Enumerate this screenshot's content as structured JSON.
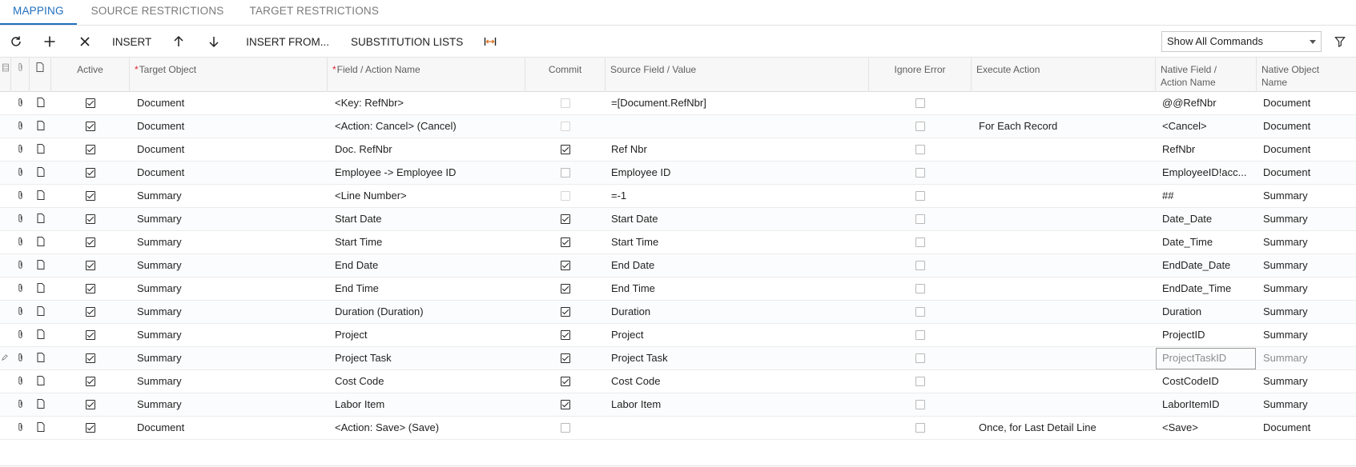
{
  "tabs": [
    {
      "label": "MAPPING",
      "active": true
    },
    {
      "label": "SOURCE RESTRICTIONS",
      "active": false
    },
    {
      "label": "TARGET RESTRICTIONS",
      "active": false
    }
  ],
  "toolbar": {
    "refresh_icon": "refresh-icon",
    "add_icon": "plus-icon",
    "delete_icon": "close-icon",
    "insert_label": "INSERT",
    "move_up_icon": "arrow-up-icon",
    "move_down_icon": "arrow-down-icon",
    "insert_from_label": "INSERT FROM...",
    "substitution_lists_label": "SUBSTITUTION LISTS",
    "fit_columns_icon": "fit-columns-icon",
    "commands_select": {
      "value": "Show All Commands"
    },
    "filter_icon": "filter-icon"
  },
  "grid": {
    "headers": {
      "active": "Active",
      "target_object": "Target Object",
      "field_action_name": "Field / Action Name",
      "commit": "Commit",
      "source_field_value": "Source Field / Value",
      "ignore_error": "Ignore Error",
      "execute_action": "Execute Action",
      "native_field_line1": "Native Field /",
      "native_field_line2": "Action Name",
      "native_object_line1": "Native Object",
      "native_object_line2": "Name"
    },
    "rows": [
      {
        "active": true,
        "target": "Document",
        "field": "<Key: RefNbr>",
        "commit": false,
        "commit_disabled": true,
        "source": "=[Document.RefNbr]",
        "ignore": false,
        "execute": "",
        "native_field": "@@RefNbr",
        "native_object": "Document"
      },
      {
        "active": true,
        "target": "Document",
        "field": "<Action: Cancel> (Cancel)",
        "commit": false,
        "commit_disabled": true,
        "source": "",
        "ignore": false,
        "execute": "For Each Record",
        "native_field": "<Cancel>",
        "native_object": "Document"
      },
      {
        "active": true,
        "target": "Document",
        "field": "Doc. RefNbr",
        "commit": true,
        "commit_disabled": false,
        "source": "Ref Nbr",
        "ignore": false,
        "execute": "",
        "native_field": "RefNbr",
        "native_object": "Document"
      },
      {
        "active": true,
        "target": "Document",
        "field": "Employee -> Employee ID",
        "commit": false,
        "commit_disabled": false,
        "source": "Employee ID",
        "ignore": false,
        "execute": "",
        "native_field": "EmployeeID!acc...",
        "native_object": "Document"
      },
      {
        "active": true,
        "target": "Summary",
        "field": "<Line Number>",
        "commit": false,
        "commit_disabled": true,
        "source": "=-1",
        "ignore": false,
        "execute": "",
        "native_field": "##",
        "native_object": "Summary"
      },
      {
        "active": true,
        "target": "Summary",
        "field": "Start Date",
        "commit": true,
        "commit_disabled": false,
        "source": "Start Date",
        "ignore": false,
        "execute": "",
        "native_field": "Date_Date",
        "native_object": "Summary"
      },
      {
        "active": true,
        "target": "Summary",
        "field": "Start Time",
        "commit": true,
        "commit_disabled": false,
        "source": "Start Time",
        "ignore": false,
        "execute": "",
        "native_field": "Date_Time",
        "native_object": "Summary"
      },
      {
        "active": true,
        "target": "Summary",
        "field": "End Date",
        "commit": true,
        "commit_disabled": false,
        "source": "End Date",
        "ignore": false,
        "execute": "",
        "native_field": "EndDate_Date",
        "native_object": "Summary"
      },
      {
        "active": true,
        "target": "Summary",
        "field": "End Time",
        "commit": true,
        "commit_disabled": false,
        "source": "End Time",
        "ignore": false,
        "execute": "",
        "native_field": "EndDate_Time",
        "native_object": "Summary"
      },
      {
        "active": true,
        "target": "Summary",
        "field": "Duration (Duration)",
        "commit": true,
        "commit_disabled": false,
        "source": "Duration",
        "ignore": false,
        "execute": "",
        "native_field": "Duration",
        "native_object": "Summary"
      },
      {
        "active": true,
        "target": "Summary",
        "field": "Project",
        "commit": true,
        "commit_disabled": false,
        "source": "Project",
        "ignore": false,
        "execute": "",
        "native_field": "ProjectID",
        "native_object": "Summary"
      },
      {
        "active": true,
        "target": "Summary",
        "field": "Project Task",
        "commit": true,
        "commit_disabled": false,
        "source": "Project Task",
        "ignore": false,
        "execute": "",
        "native_field": "ProjectTaskID",
        "native_object": "Summary",
        "editing": true
      },
      {
        "active": true,
        "target": "Summary",
        "field": "Cost Code",
        "commit": true,
        "commit_disabled": false,
        "source": "Cost Code",
        "ignore": false,
        "execute": "",
        "native_field": "CostCodeID",
        "native_object": "Summary"
      },
      {
        "active": true,
        "target": "Summary",
        "field": "Labor Item",
        "commit": true,
        "commit_disabled": false,
        "source": "Labor Item",
        "ignore": false,
        "execute": "",
        "native_field": "LaborItemID",
        "native_object": "Summary"
      },
      {
        "active": true,
        "target": "Document",
        "field": "<Action: Save> (Save)",
        "commit": false,
        "commit_disabled": false,
        "source": "",
        "ignore": false,
        "execute": "Once, for Last Detail Line",
        "native_field": "<Save>",
        "native_object": "Document"
      }
    ]
  },
  "colors": {
    "accent": "#1f6fbf",
    "required": "#dd2233"
  }
}
